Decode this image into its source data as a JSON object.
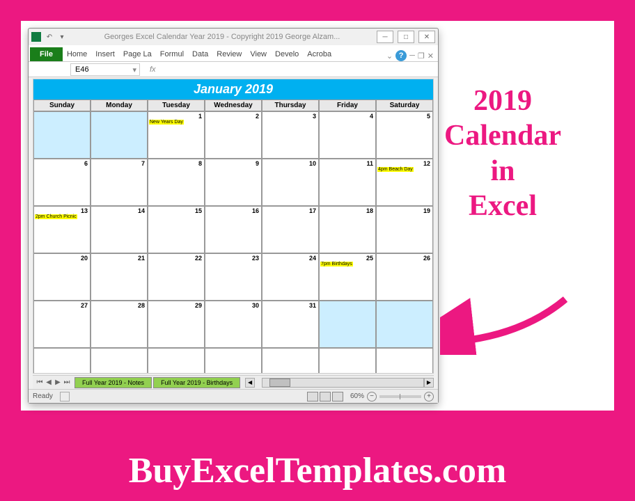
{
  "window": {
    "title": "Georges Excel Calendar Year 2019 - Copyright 2019 George Alzam..."
  },
  "ribbon": {
    "file": "File",
    "tabs": [
      "Home",
      "Insert",
      "Page La",
      "Formul",
      "Data",
      "Review",
      "View",
      "Develo",
      "Acroba"
    ]
  },
  "formula_bar": {
    "name_box": "E46",
    "fx": "fx"
  },
  "calendar": {
    "title": "January 2019",
    "day_names": [
      "Sunday",
      "Monday",
      "Tuesday",
      "Wednesday",
      "Thursday",
      "Friday",
      "Saturday"
    ],
    "cells": [
      {
        "num": "",
        "blank": true
      },
      {
        "num": "",
        "blank": true
      },
      {
        "num": "1",
        "event": "New Years Day"
      },
      {
        "num": "2"
      },
      {
        "num": "3"
      },
      {
        "num": "4"
      },
      {
        "num": "5"
      },
      {
        "num": "6"
      },
      {
        "num": "7"
      },
      {
        "num": "8"
      },
      {
        "num": "9"
      },
      {
        "num": "10"
      },
      {
        "num": "11"
      },
      {
        "num": "12",
        "event": "4pm Beach Day"
      },
      {
        "num": "13",
        "event": "2pm Church Picnic"
      },
      {
        "num": "14"
      },
      {
        "num": "15"
      },
      {
        "num": "16"
      },
      {
        "num": "17"
      },
      {
        "num": "18"
      },
      {
        "num": "19"
      },
      {
        "num": "20"
      },
      {
        "num": "21"
      },
      {
        "num": "22"
      },
      {
        "num": "23"
      },
      {
        "num": "24"
      },
      {
        "num": "25",
        "event": "7pm Birthdays"
      },
      {
        "num": "26"
      },
      {
        "num": "27"
      },
      {
        "num": "28"
      },
      {
        "num": "29"
      },
      {
        "num": "30"
      },
      {
        "num": "31"
      },
      {
        "num": "",
        "blank": true
      },
      {
        "num": "",
        "blank": true
      },
      {
        "num": ""
      },
      {
        "num": ""
      },
      {
        "num": ""
      },
      {
        "num": ""
      },
      {
        "num": ""
      },
      {
        "num": ""
      },
      {
        "num": ""
      }
    ]
  },
  "sheets": {
    "tabs": [
      "Full Year 2019 - Notes",
      "Full Year 2019 - Birthdays"
    ]
  },
  "status": {
    "ready": "Ready",
    "zoom": "60%"
  },
  "promo": {
    "line1": "2019",
    "line2": "Calendar",
    "line3": "in",
    "line4": "Excel"
  },
  "footer": "BuyExcelTemplates.com"
}
